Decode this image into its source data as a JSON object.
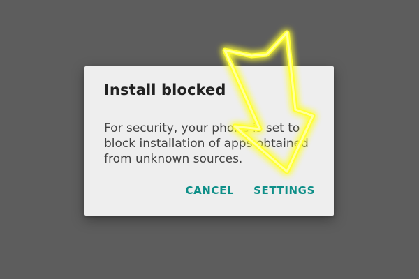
{
  "dialog": {
    "title": "Install blocked",
    "message": "For security, your phone is set to block installation of apps obtained from unknown sources.",
    "cancel_label": "CANCEL",
    "settings_label": "SETTINGS"
  },
  "colors": {
    "background": "#5d5d5d",
    "dialog_surface": "#eeeeee",
    "accent": "#0e8f88",
    "highlight_arrow": "#ffff33"
  },
  "overlay": {
    "icon": "lightning-arrow-icon"
  }
}
